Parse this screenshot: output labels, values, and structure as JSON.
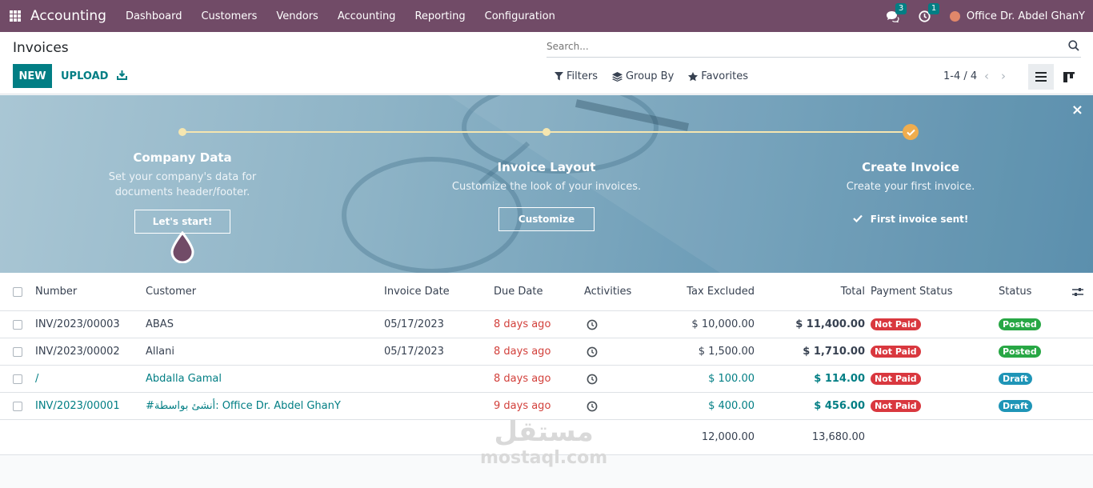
{
  "topnav": {
    "brand": "Accounting",
    "menu": [
      "Dashboard",
      "Customers",
      "Vendors",
      "Accounting",
      "Reporting",
      "Configuration"
    ],
    "messages_count": "3",
    "activities_count": "1",
    "company": "Office Dr. Abdel GhanY"
  },
  "control": {
    "title": "Invoices",
    "new_label": "NEW",
    "upload_label": "UPLOAD",
    "search_placeholder": "Search...",
    "filters_label": "Filters",
    "groupby_label": "Group By",
    "favorites_label": "Favorites",
    "pager": "1-4 / 4"
  },
  "banner": {
    "steps": [
      {
        "title": "Company Data",
        "desc": "Set your company's data for documents header/footer.",
        "button": "Let's start!"
      },
      {
        "title": "Invoice Layout",
        "desc": "Customize the look of your invoices.",
        "button": "Customize"
      },
      {
        "title": "Create Invoice",
        "desc": "Create your first invoice.",
        "done_label": "First invoice sent!"
      }
    ]
  },
  "table": {
    "headers": {
      "number": "Number",
      "customer": "Customer",
      "invoice_date": "Invoice Date",
      "due_date": "Due Date",
      "activities": "Activities",
      "tax_excluded": "Tax Excluded",
      "total": "Total",
      "payment_status": "Payment Status",
      "status": "Status"
    },
    "rows": [
      {
        "number": "INV/2023/00003",
        "customer": "ABAS",
        "invoice_date": "05/17/2023",
        "due_date": "8 days ago",
        "tax_excluded": "$ 10,000.00",
        "total": "$ 11,400.00",
        "payment_status": "Not Paid",
        "status": "Posted"
      },
      {
        "number": "INV/2023/00002",
        "customer": "Allani",
        "invoice_date": "05/17/2023",
        "due_date": "8 days ago",
        "tax_excluded": "$ 1,500.00",
        "total": "$ 1,710.00",
        "payment_status": "Not Paid",
        "status": "Posted"
      },
      {
        "number": "/",
        "customer": "Abdalla Gamal",
        "invoice_date": "",
        "due_date": "8 days ago",
        "tax_excluded": "$ 100.00",
        "total": "$ 114.00",
        "payment_status": "Not Paid",
        "status": "Draft"
      },
      {
        "number": "INV/2023/00001",
        "customer": "#أنشئ بواسطة: Office Dr. Abdel GhanY",
        "invoice_date": "",
        "due_date": "9 days ago",
        "tax_excluded": "$ 400.00",
        "total": "$ 456.00",
        "payment_status": "Not Paid",
        "status": "Draft"
      }
    ],
    "totals": {
      "tax_excluded": "12,000.00",
      "total": "13,680.00"
    }
  },
  "watermark": {
    "arabic": "مستقل",
    "latin": "mostaql.com"
  },
  "colors": {
    "nav": "#714b67",
    "primary": "#017e84",
    "not_paid": "#d9383f",
    "posted": "#28a745",
    "draft": "#1f95b7"
  }
}
